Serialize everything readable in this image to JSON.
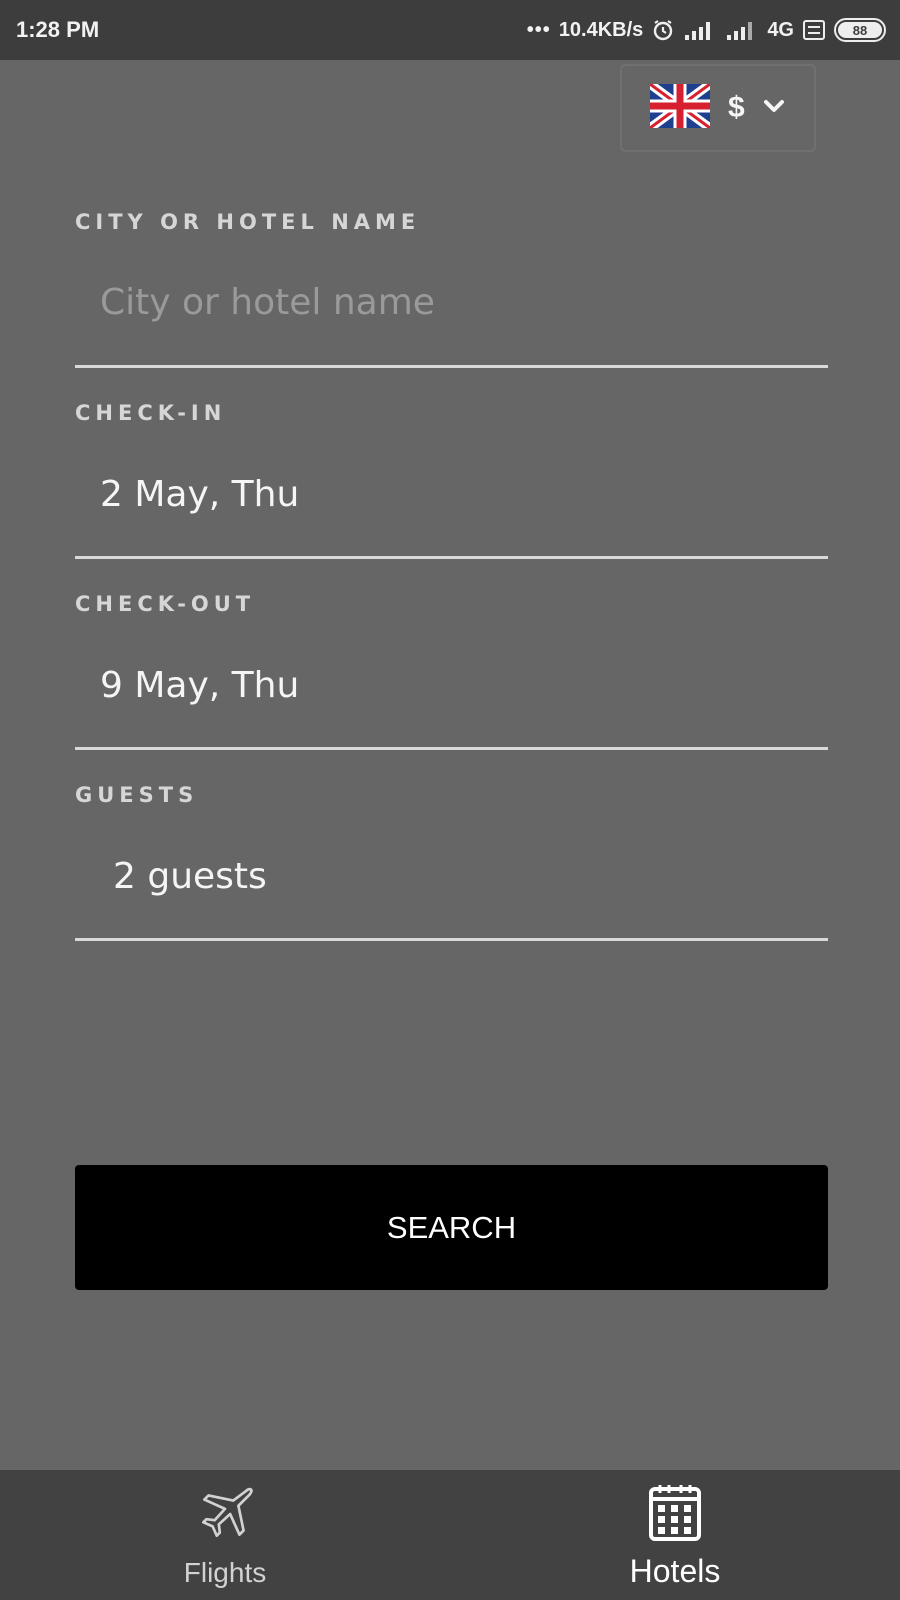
{
  "status_bar": {
    "time": "1:28 PM",
    "net_speed": "10.4KB/s",
    "network_type": "4G",
    "battery": "88"
  },
  "locale": {
    "flag_icon": "uk-flag-icon",
    "currency": "$",
    "dropdown_icon": "chevron-down-icon"
  },
  "form": {
    "destination": {
      "label": "CITY OR HOTEL NAME",
      "placeholder": "City or hotel name",
      "value": ""
    },
    "check_in": {
      "label": "CHECK-IN",
      "value": "2 May, Thu"
    },
    "check_out": {
      "label": "CHECK-OUT",
      "value": "9 May, Thu"
    },
    "guests": {
      "label": "GUESTS",
      "value": "2 guests"
    }
  },
  "search_button": {
    "label": "SEARCH"
  },
  "bottom_nav": {
    "items": [
      {
        "label": "Flights",
        "icon": "airplane-icon",
        "active": false
      },
      {
        "label": "Hotels",
        "icon": "building-icon",
        "active": true
      }
    ]
  },
  "colors": {
    "background": "#666666",
    "status_bar": "#3d3d3d",
    "bottom_nav": "#424242",
    "button": "#000000"
  }
}
